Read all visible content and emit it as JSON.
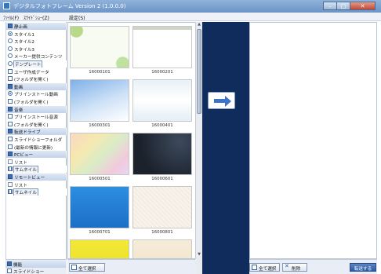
{
  "window": {
    "title": "デジタルフォトフレーム Version 2 (1.0.0.0)",
    "controls": {
      "minimize": "–",
      "maximize": "□",
      "close": "✕"
    }
  },
  "menubar": {
    "items": [
      "ﾌｧｲﾙ(F)",
      "ｽﾗｲﾄﾞｼｮｰ(Z)",
      "設定(S)"
    ]
  },
  "sidebar": {
    "items": [
      {
        "label": "静止画",
        "type": "header"
      },
      {
        "label": "スタイル1",
        "type": "radio",
        "on": true
      },
      {
        "label": "スタイル2",
        "type": "radio"
      },
      {
        "label": "スタイル3",
        "type": "radio"
      },
      {
        "label": "メーカー提供コンテンツ",
        "type": "radio"
      },
      {
        "label": "テンプレート",
        "type": "radio",
        "selected": true
      },
      {
        "label": "ユーザ作成データ",
        "type": "check"
      },
      {
        "label": "(フォルダを開く)",
        "type": "check"
      },
      {
        "label": "動画",
        "type": "header"
      },
      {
        "label": "プリインストール動画",
        "type": "radio",
        "on": true
      },
      {
        "label": "(フォルダを開く)",
        "type": "check"
      },
      {
        "label": "音楽",
        "type": "header"
      },
      {
        "label": "プリインストール音源",
        "type": "check"
      },
      {
        "label": "(フォルダを開く)",
        "type": "check"
      },
      {
        "label": "転送ドライブ",
        "type": "header"
      },
      {
        "label": "スライドショーフォルダ",
        "type": "check"
      },
      {
        "label": "(最新の情報に更新)",
        "type": "check"
      },
      {
        "label": "PCビュー",
        "type": "header"
      },
      {
        "label": "リスト",
        "type": "list"
      },
      {
        "label": "サムネイル",
        "type": "grid",
        "selected": true
      },
      {
        "label": "リモートビュー",
        "type": "header"
      },
      {
        "label": "リスト",
        "type": "list"
      },
      {
        "label": "サムネイル",
        "type": "grid",
        "selected": true
      }
    ],
    "footer_items": [
      {
        "label": "機能",
        "type": "header"
      },
      {
        "label": "スライドショー",
        "type": "check"
      }
    ]
  },
  "gallery": {
    "thumbnails": [
      {
        "caption": "16000101",
        "style": "floral"
      },
      {
        "caption": "16000201",
        "style": "frame"
      },
      {
        "caption": "16000301",
        "style": "sky"
      },
      {
        "caption": "16000401",
        "style": "white"
      },
      {
        "caption": "16000501",
        "style": "pastel"
      },
      {
        "caption": "16000601",
        "style": "dark"
      },
      {
        "caption": "16000701",
        "style": "blue"
      },
      {
        "caption": "16000801",
        "style": "paper"
      },
      {
        "caption": "",
        "style": "yellow"
      },
      {
        "caption": "",
        "style": "beige"
      }
    ]
  },
  "bottom_left": {
    "select_all_label": "全て選択"
  },
  "bottom_right": {
    "select_all_label": "全て選択",
    "delete_label": "削除",
    "transfer_label": "転送する"
  },
  "colors": {
    "mid_panel": "#102c5c",
    "accent": "#3b74c9",
    "header_bg": "#c2d3ea"
  }
}
